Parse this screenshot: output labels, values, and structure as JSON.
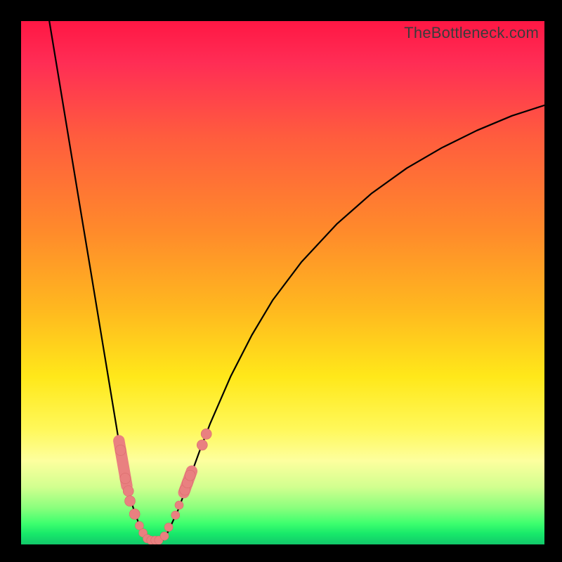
{
  "watermark": "TheBottleneck.com",
  "colors": {
    "frame": "#000000",
    "curve": "#000000",
    "marker_fill": "#e98080",
    "marker_stroke": "#d86a6a",
    "gradient_stops": [
      "#ff1744",
      "#ff5c3e",
      "#ffb81f",
      "#ffe81a",
      "#fdff9e",
      "#3dff6e",
      "#12c86a"
    ]
  },
  "chart_data": {
    "type": "line",
    "title": "",
    "xlabel": "",
    "ylabel": "",
    "xlim": [
      0,
      100
    ],
    "ylim": [
      0,
      100
    ],
    "note": "y measured from bottom (0) to top (100); x from left (0) to right (100). Two curve branches meet near the floor around x≈24-28.",
    "series": [
      {
        "name": "left-branch",
        "x": [
          5.4,
          7.4,
          9.4,
          11.4,
          13.4,
          15.4,
          17.4,
          19.4,
          20.4,
          21.4,
          22.4,
          23.4,
          24.1
        ],
        "y": [
          100.0,
          87.9,
          75.8,
          63.7,
          51.7,
          39.6,
          27.5,
          15.4,
          10.8,
          7.1,
          4.2,
          2.0,
          0.8
        ]
      },
      {
        "name": "right-branch",
        "x": [
          27.0,
          28.0,
          29.0,
          30.1,
          32.1,
          34.1,
          36.1,
          40.1,
          44.1,
          48.1,
          53.6,
          60.3,
          67.0,
          73.7,
          80.4,
          87.1,
          93.8,
          100.0
        ],
        "y": [
          0.8,
          2.3,
          4.4,
          6.8,
          12.3,
          17.8,
          23.0,
          32.2,
          40.0,
          46.7,
          54.0,
          61.2,
          67.1,
          71.9,
          75.8,
          79.1,
          81.9,
          83.9
        ]
      }
    ],
    "floor_segment": {
      "x": [
        24.1,
        27.0
      ],
      "y": [
        0.8,
        0.8
      ]
    },
    "markers_left_branch": [
      {
        "x": 19.0,
        "y": 18.0,
        "r": 1.0
      },
      {
        "x": 19.9,
        "y": 12.6,
        "r": 1.0
      },
      {
        "x": 20.5,
        "y": 10.2,
        "r": 1.0
      },
      {
        "x": 20.8,
        "y": 8.3,
        "r": 1.0
      },
      {
        "x": 21.7,
        "y": 5.8,
        "r": 1.0
      },
      {
        "x": 22.6,
        "y": 3.6,
        "r": 0.8
      },
      {
        "x": 23.3,
        "y": 2.2,
        "r": 0.8
      },
      {
        "x": 24.1,
        "y": 1.1,
        "r": 0.8
      }
    ],
    "markers_floor": [
      {
        "x": 24.8,
        "y": 0.8,
        "r": 0.8
      },
      {
        "x": 25.6,
        "y": 0.8,
        "r": 0.8
      },
      {
        "x": 26.3,
        "y": 0.8,
        "r": 0.8
      }
    ],
    "markers_right_branch": [
      {
        "x": 27.4,
        "y": 1.6,
        "r": 0.8
      },
      {
        "x": 28.2,
        "y": 3.3,
        "r": 0.8
      },
      {
        "x": 29.5,
        "y": 5.6,
        "r": 0.8
      },
      {
        "x": 30.2,
        "y": 7.5,
        "r": 0.8
      },
      {
        "x": 31.3,
        "y": 10.4,
        "r": 1.0
      },
      {
        "x": 31.8,
        "y": 11.8,
        "r": 1.0
      },
      {
        "x": 32.3,
        "y": 13.2,
        "r": 1.0
      },
      {
        "x": 34.6,
        "y": 19.0,
        "r": 1.0
      },
      {
        "x": 35.4,
        "y": 21.1,
        "r": 1.0
      }
    ],
    "left_capsule": {
      "x0": 18.7,
      "y0": 19.8,
      "x1": 20.2,
      "y1": 11.2,
      "r": 1.1
    },
    "right_capsule": {
      "x0": 31.1,
      "y0": 9.9,
      "x1": 32.6,
      "y1": 14.0,
      "r": 1.1
    }
  }
}
